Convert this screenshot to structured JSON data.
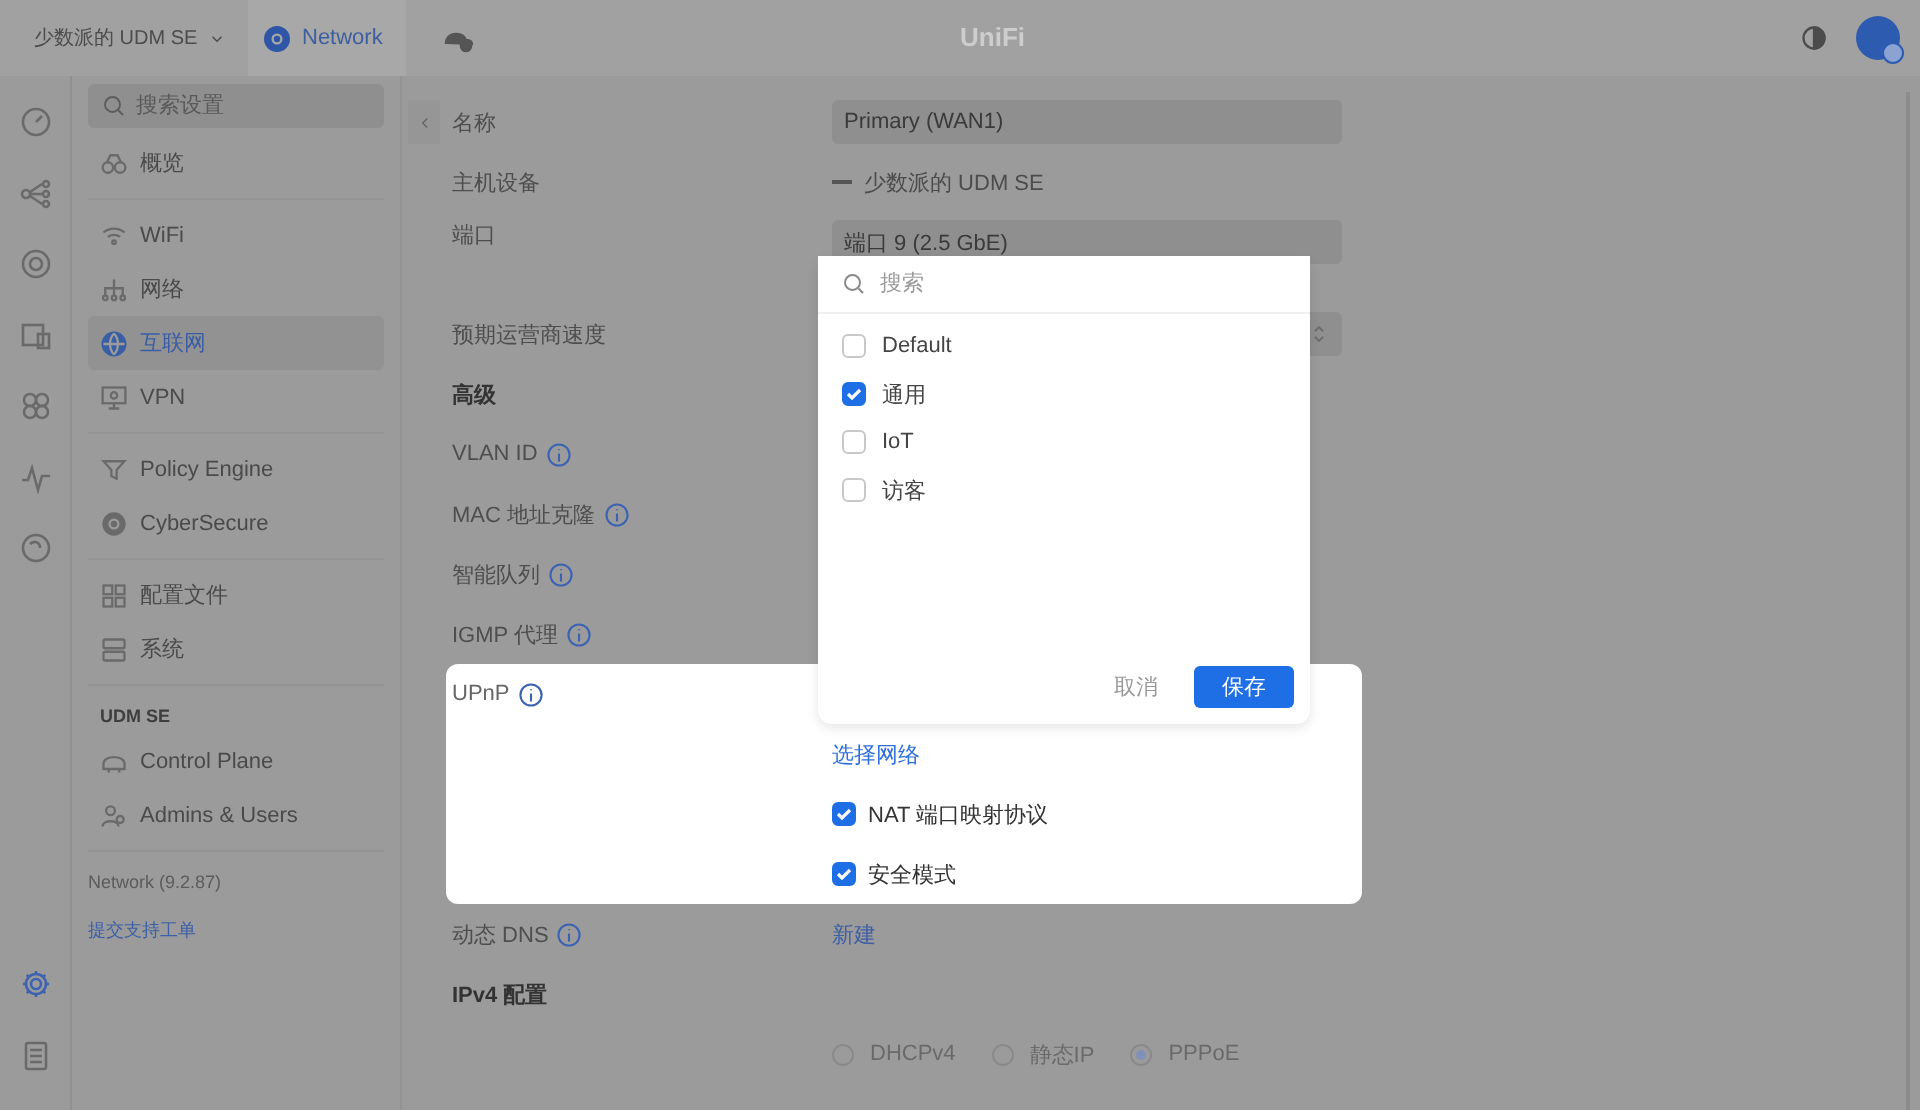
{
  "topbar": {
    "site": "少数派的 UDM SE",
    "app_tab": {
      "label": "Network",
      "selected": true
    },
    "title": "UniFi"
  },
  "rail": [
    {
      "kind": "dashboard",
      "selected": false
    },
    {
      "kind": "topology",
      "selected": false
    },
    {
      "kind": "devices",
      "selected": false
    },
    {
      "kind": "clients",
      "selected": false
    },
    {
      "kind": "apps",
      "selected": false
    },
    {
      "kind": "insights",
      "selected": false
    },
    {
      "kind": "shield",
      "selected": false
    }
  ],
  "rail_bottom": [
    {
      "kind": "settings",
      "selected": true
    },
    {
      "kind": "log",
      "selected": false
    }
  ],
  "sidebar": {
    "search_placeholder": "搜索设置",
    "groups": [
      {
        "items": [
          {
            "label": "概览",
            "kind": "overview",
            "selected": false
          }
        ]
      },
      {
        "items": [
          {
            "label": "WiFi",
            "kind": "wifi",
            "selected": false
          },
          {
            "label": "网络",
            "kind": "network",
            "selected": false
          },
          {
            "label": "互联网",
            "kind": "internet",
            "selected": true
          },
          {
            "label": "VPN",
            "kind": "vpn",
            "selected": false
          }
        ]
      },
      {
        "items": [
          {
            "label": "Policy Engine",
            "kind": "policy",
            "selected": false
          },
          {
            "label": "CyberSecure",
            "kind": "cyber",
            "selected": false
          }
        ]
      },
      {
        "items": [
          {
            "label": "配置文件",
            "kind": "profiles",
            "selected": false
          },
          {
            "label": "系统",
            "kind": "system",
            "selected": false
          }
        ]
      },
      {
        "title": "UDM SE",
        "items": [
          {
            "label": "Control Plane",
            "kind": "plane",
            "selected": false
          },
          {
            "label": "Admins & Users",
            "kind": "admins",
            "selected": false
          }
        ]
      }
    ],
    "version": "Network (9.2.87)",
    "support_link": "提交支持工单"
  },
  "form": {
    "rows": [
      {
        "kind": "field",
        "label": "名称",
        "value": "Primary (WAN1)"
      },
      {
        "kind": "device",
        "label": "主机设备",
        "value": "少数派的 UDM SE"
      },
      {
        "kind": "select",
        "label": "端口",
        "value": "端口 9 (2.5 GbE)"
      },
      {
        "kind": "number",
        "label": "预期运营商速度"
      },
      {
        "kind": "heading",
        "label": "高级"
      },
      {
        "kind": "info",
        "label": "VLAN ID"
      },
      {
        "kind": "info",
        "label": "MAC 地址克隆"
      },
      {
        "kind": "info",
        "label": "智能队列"
      },
      {
        "kind": "info",
        "label": "IGMP 代理"
      },
      {
        "kind": "upnp",
        "label": "UPnP",
        "link": "选择网络",
        "options": [
          {
            "label": "NAT 端口映射协议",
            "checked": true
          },
          {
            "label": "安全模式",
            "checked": true
          }
        ]
      },
      {
        "kind": "link",
        "label": "动态 DNS",
        "link": "新建"
      },
      {
        "kind": "heading",
        "label": "IPv4 配置"
      },
      {
        "kind": "radios",
        "options": [
          {
            "label": "DHCPv4",
            "selected": false
          },
          {
            "label": "静态IP",
            "selected": false
          },
          {
            "label": "PPPoE",
            "selected": true
          }
        ]
      }
    ]
  },
  "popup": {
    "search_placeholder": "搜索",
    "items": [
      {
        "label": "Default",
        "checked": false
      },
      {
        "label": "通用",
        "checked": true
      },
      {
        "label": "IoT",
        "checked": false
      },
      {
        "label": "访客",
        "checked": false
      }
    ],
    "cancel": "取消",
    "save": "保存"
  }
}
